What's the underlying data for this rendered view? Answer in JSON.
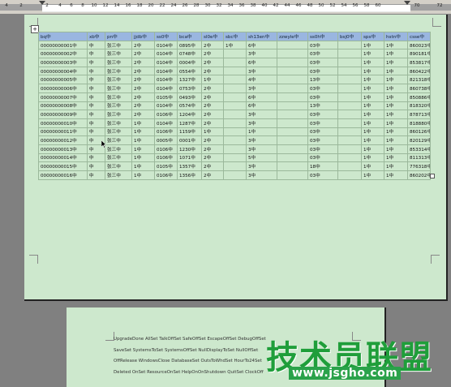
{
  "ruler": {
    "ticks": [
      "4",
      "2",
      "2",
      "4",
      "6",
      "8",
      "10",
      "12",
      "14",
      "16",
      "18",
      "20",
      "22",
      "24",
      "26",
      "28",
      "30",
      "32",
      "34",
      "36",
      "38",
      "40",
      "42",
      "44",
      "46",
      "48",
      "50",
      "52",
      "54",
      "56",
      "58",
      "60",
      "70",
      "72"
    ]
  },
  "table": {
    "headers": [
      "bq中",
      "xb中",
      "pn中",
      "jjdb中",
      "ss0中",
      "bca中",
      "sl0e中",
      "sbc中",
      "sh13en中",
      "zzwyle中",
      "ss0h中",
      "bsj0中",
      "sps中",
      "hstn中",
      "csse中"
    ],
    "rows": [
      [
        "00000000001中",
        "中",
        "张三中",
        "2中",
        "0104中",
        "0895中",
        "2中",
        "1中",
        "6中",
        "",
        "03中",
        "",
        "1中",
        "1中",
        "860023中"
      ],
      [
        "00000000002中",
        "中",
        "张三中",
        "2中",
        "0104中",
        "0748中",
        "2中",
        "",
        "3中",
        "",
        "03中",
        "",
        "1中",
        "1中",
        "890181中"
      ],
      [
        "00000000003中",
        "中",
        "张三中",
        "2中",
        "0104中",
        "0004中",
        "2中",
        "",
        "6中",
        "",
        "03中",
        "",
        "1中",
        "1中",
        "853817中"
      ],
      [
        "00000000004中",
        "中",
        "张三中",
        "2中",
        "0104中",
        "0554中",
        "2中",
        "",
        "3中",
        "",
        "03中",
        "",
        "1中",
        "1中",
        "860422中"
      ],
      [
        "00000000005中",
        "中",
        "张三中",
        "2中",
        "0104中",
        "1327中",
        "1中",
        "",
        "4中",
        "",
        "13中",
        "",
        "1中",
        "1中",
        "821318中"
      ],
      [
        "00000000006中",
        "中",
        "张三中",
        "2中",
        "0104中",
        "0753中",
        "2中",
        "",
        "3中",
        "",
        "03中",
        "",
        "1中",
        "1中",
        "860738中"
      ],
      [
        "00000000007中",
        "中",
        "张三中",
        "2中",
        "0105中",
        "0493中",
        "2中",
        "",
        "6中",
        "",
        "03中",
        "",
        "1中",
        "1中",
        "850886中"
      ],
      [
        "00000000008中",
        "中",
        "张三中",
        "2中",
        "0104中",
        "0574中",
        "2中",
        "",
        "6中",
        "",
        "13中",
        "",
        "1中",
        "1中",
        "818320中"
      ],
      [
        "00000000009中",
        "中",
        "张三中",
        "2中",
        "0106中",
        "1204中",
        "2中",
        "",
        "3中",
        "",
        "03中",
        "",
        "1中",
        "1中",
        "878713中"
      ],
      [
        "00000000010中",
        "中",
        "张三中",
        "1中",
        "0104中",
        "1287中",
        "2中",
        "",
        "3中",
        "",
        "03中",
        "",
        "1中",
        "1中",
        "818880中"
      ],
      [
        "00000000011中",
        "中",
        "张三中",
        "1中",
        "0106中",
        "1159中",
        "1中",
        "",
        "1中",
        "",
        "03中",
        "",
        "1中",
        "1中",
        "860126中"
      ],
      [
        "00000000012中",
        "中",
        "张三中",
        "1中",
        "0005中",
        "0001中",
        "2中",
        "",
        "3中",
        "",
        "03中",
        "",
        "1中",
        "1中",
        "820129中"
      ],
      [
        "00000000013中",
        "中",
        "张三中",
        "1中",
        "0106中",
        "1230中",
        "2中",
        "",
        "3中",
        "",
        "03中",
        "",
        "1中",
        "1中",
        "853314中"
      ],
      [
        "00000000014中",
        "中",
        "张三中",
        "1中",
        "0106中",
        "1071中",
        "2中",
        "",
        "5中",
        "",
        "03中",
        "",
        "1中",
        "1中",
        "811313中"
      ],
      [
        "00000000015中",
        "中",
        "张三中",
        "1中",
        "0105中",
        "1357中",
        "2中",
        "",
        "3中",
        "",
        "18中",
        "",
        "1中",
        "1中",
        "776318中"
      ],
      [
        "00000000016中",
        "中",
        "张三中",
        "1中",
        "0106中",
        "1356中",
        "2中",
        "",
        "3中",
        "",
        "03中",
        "",
        "1中",
        "1中",
        "860202中"
      ]
    ]
  },
  "page2": {
    "lines": [
      "UpgradeDone AllSet TalkOffSet SafeOffSet EscapeOffSet DebugOffSet",
      "SaveSet SystemsToSet SystemsOffSet NullDisplayToSet NullOffSet",
      "OffRelease WindowsClose DatabaseSet OutsToWhdSet HourTo24Set",
      "Deleted OnSet ResourceOnSet HelpOnOnShutdown QuitSet ClockOff"
    ]
  },
  "watermark": {
    "text": "技术员联盟",
    "url": "www.jsgho.com"
  },
  "colors": {
    "page_bg": "#cde8cd",
    "header_bg": "#9ab6e0",
    "workspace_bg": "#808080",
    "watermark": "#1f9e3a"
  }
}
